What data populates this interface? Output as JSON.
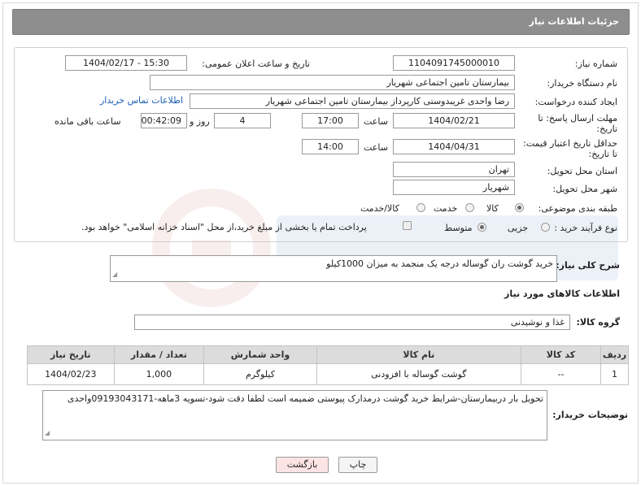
{
  "header": {
    "title": "جزئیات اطلاعات نیاز"
  },
  "form": {
    "need_number_label": "شماره نیاز:",
    "need_number": "1104091745000010",
    "announce_label": "تاریخ و ساعت اعلان عمومی:",
    "announce_value": "1404/02/17 - 15:30",
    "buyer_org_label": "نام دستگاه خریدار:",
    "buyer_org": "بیمارستان تامین اجتماعی شهریار",
    "requester_label": "ایجاد کننده درخواست:",
    "requester": "رضا واحدی غریبدوستی کارپرداز بیمارستان تامین اجتماعی شهریار",
    "contact_link": "اطلاعات تماس خریدار",
    "reply_deadline_label_1": "مهلت ارسال پاسخ: تا",
    "reply_deadline_label_2": "تاریخ:",
    "reply_date": "1404/02/21",
    "time_label": "ساعت",
    "reply_time": "17:00",
    "days_value": "4",
    "days_label": "روز و",
    "remaining_time": "00:42:09",
    "remaining_label": "ساعت باقی مانده",
    "validity_label_1": "حداقل تاریخ اعتبار قیمت:",
    "validity_label_2": "تا تاریخ:",
    "validity_date": "1404/04/31",
    "validity_time": "14:00",
    "province_label": "استان محل تحویل:",
    "province": "تهران",
    "city_label": "شهر محل تحویل:",
    "city": "شهریار",
    "category_label": "طبقه بندی موضوعی:",
    "category_options": [
      "کالا",
      "خدمت",
      "کالا/خدمت"
    ],
    "category_selected": "کالا",
    "process_label": "نوع فرآیند خرید :",
    "process_options": [
      "جزیی",
      "متوسط"
    ],
    "process_selected": "متوسط",
    "payment_note": "پرداخت تمام یا بخشی از مبلغ خرید،از محل \"اسناد خزانه اسلامی\" خواهد بود."
  },
  "description": {
    "label": "شرح کلی نیاز:",
    "value": "خرید گوشت ران گوساله درجه یک منجمد به میزان 1000کیلو"
  },
  "goods": {
    "section_title": "اطلاعات کالاهای مورد نیاز",
    "group_label": "گروه کالا:",
    "group_value": "غذا و نوشیدنی",
    "columns": [
      "ردیف",
      "کد کالا",
      "نام کالا",
      "واحد شمارش",
      "تعداد / مقدار",
      "تاریخ نیاز"
    ],
    "rows": [
      [
        "1",
        "--",
        "گوشت گوساله با افزودنی",
        "کیلوگرم",
        "1,000",
        "1404/02/23"
      ]
    ]
  },
  "buyer_notes": {
    "label": "توضیحات خریدار:",
    "value": "تحویل بار دربیمارستان-شرایط خرید گوشت درمدارک پیوستی ضمیمه است لطفا دقت شود-تسویه 3ماهه-09193043171واحدی"
  },
  "buttons": {
    "print": "چاپ",
    "back": "بازگشت"
  },
  "colors": {
    "header_bg": "#8e8e8e",
    "link": "#1a5fb4",
    "back_btn_bg": "#fde4e4",
    "table_header_bg": "#dcdcdc"
  }
}
